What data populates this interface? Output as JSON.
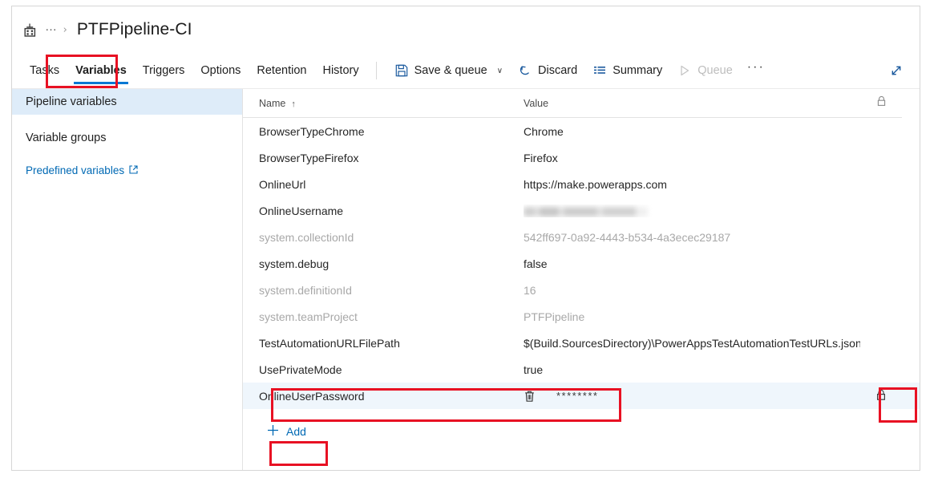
{
  "header": {
    "pipeline_icon": "build-pipeline-icon",
    "ellipsis": "…",
    "chevron": "›",
    "title": "PTFPipeline-CI"
  },
  "commandbar": {
    "tabs": [
      {
        "label": "Tasks",
        "active": false
      },
      {
        "label": "Variables",
        "active": true
      },
      {
        "label": "Triggers",
        "active": false
      },
      {
        "label": "Options",
        "active": false
      },
      {
        "label": "Retention",
        "active": false
      },
      {
        "label": "History",
        "active": false
      }
    ],
    "actions": [
      {
        "label": "Save & queue",
        "icon": "save-icon",
        "caret": "∨",
        "disabled": false
      },
      {
        "label": "Discard",
        "icon": "undo-icon",
        "caret": "",
        "disabled": false
      },
      {
        "label": "Summary",
        "icon": "summary-icon",
        "caret": "",
        "disabled": false
      },
      {
        "label": "Queue",
        "icon": "play-icon",
        "caret": "",
        "disabled": true
      }
    ],
    "overflow_label": "···",
    "expand_label": "expand-icon"
  },
  "sidebar": {
    "items": [
      {
        "label": "Pipeline variables",
        "selected": true
      },
      {
        "label": "Variable groups",
        "selected": false
      }
    ],
    "link": {
      "label": "Predefined variables",
      "external_icon": "external-link-icon"
    }
  },
  "grid": {
    "columns": {
      "name": "Name",
      "value": "Value",
      "lock": "lock-icon"
    },
    "sort_arrow": "↑",
    "rows": [
      {
        "name": "BrowserTypeChrome",
        "value": "Chrome",
        "dim": false,
        "type": "text"
      },
      {
        "name": "BrowserTypeFirefox",
        "value": "Firefox",
        "dim": false,
        "type": "text"
      },
      {
        "name": "OnlineUrl",
        "value": "https://make.powerapps.com",
        "dim": false,
        "type": "text"
      },
      {
        "name": "OnlineUsername",
        "value": "",
        "dim": false,
        "type": "blurred"
      },
      {
        "name": "system.collectionId",
        "value": "542ff697-0a92-4443-b534-4a3ecec29187",
        "dim": true,
        "type": "text"
      },
      {
        "name": "system.debug",
        "value": "false",
        "dim": false,
        "type": "text"
      },
      {
        "name": "system.definitionId",
        "value": "16",
        "dim": true,
        "type": "text"
      },
      {
        "name": "system.teamProject",
        "value": "PTFPipeline",
        "dim": true,
        "type": "text"
      },
      {
        "name": "TestAutomationURLFilePath",
        "value": "$(Build.SourcesDirectory)\\PowerAppsTestAutomationTestURLs.json",
        "dim": false,
        "type": "text"
      },
      {
        "name": "UsePrivateMode",
        "value": "true",
        "dim": false,
        "type": "text"
      }
    ],
    "selected_row": {
      "name": "OnlineUserPassword",
      "value": "********",
      "delete_icon": "trash-icon",
      "lock_icon": "lock-closed-icon"
    },
    "add_button": {
      "label": "Add",
      "icon": "plus-icon"
    }
  },
  "annotations": {
    "accent_red": "#e81123",
    "accent_blue": "#0078d4",
    "selected_row_bg": "#eff6fc",
    "sidebar_selected_bg": "#deecf9",
    "boxes": [
      {
        "name": "variables-tab-highlight"
      },
      {
        "name": "password-row-highlight"
      },
      {
        "name": "lock-icon-highlight"
      },
      {
        "name": "add-button-highlight"
      }
    ]
  }
}
